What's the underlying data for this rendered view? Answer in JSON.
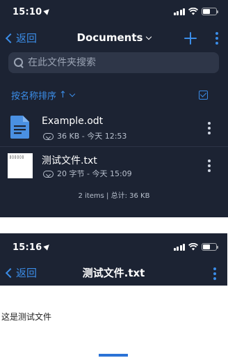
{
  "screen1": {
    "status": {
      "time": "15:10"
    },
    "nav": {
      "back_label": "返回",
      "title": "Documents"
    },
    "search": {
      "placeholder": "在此文件夹搜索"
    },
    "sort": {
      "label": "按名称排序",
      "direction_icon": "↑"
    },
    "files": [
      {
        "name": "Example.odt",
        "size": "36 KB",
        "modified": "今天 12:53",
        "icon": "document-icon"
      },
      {
        "name": "测试文件.txt",
        "size": "20 字节",
        "modified": "今天 15:09",
        "icon": "text-thumbnail",
        "thumb_text": "▯▯▯▯▯▯"
      }
    ],
    "summary": "2 items | 总计: 36 KB"
  },
  "screen2": {
    "status": {
      "time": "15:16"
    },
    "nav": {
      "back_label": "返回",
      "title": "测试文件.txt"
    },
    "content": "这是测试文件"
  },
  "colors": {
    "background": "#1c2333",
    "accent": "#3b8de8",
    "search_bg": "#2e3648"
  }
}
